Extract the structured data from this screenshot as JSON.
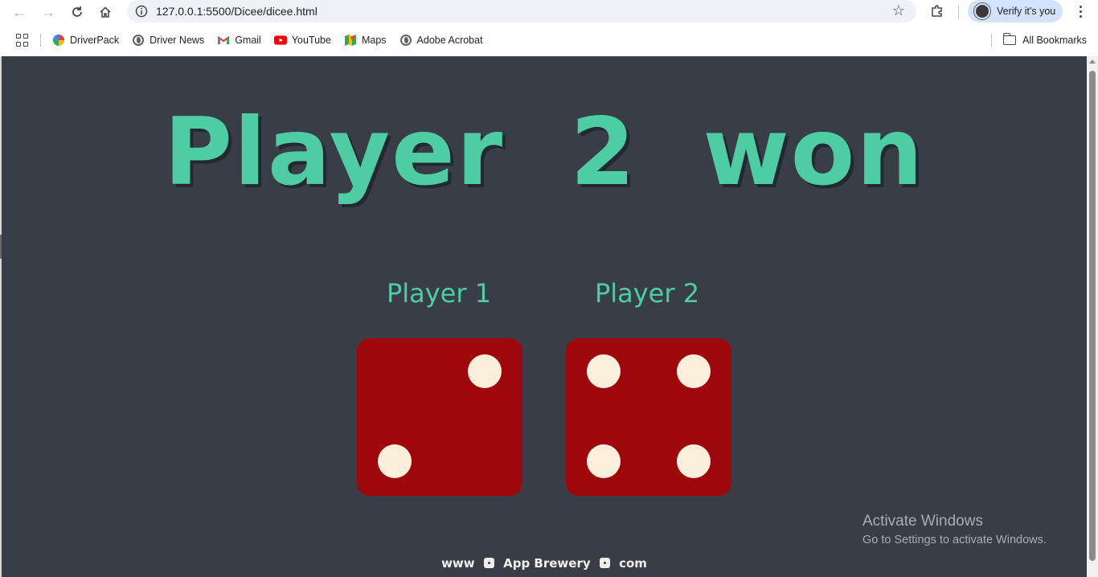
{
  "browser": {
    "url": "127.0.0.1:5500/Dicee/dicee.html",
    "profile_label": "Verify it's you",
    "bookmarks": [
      {
        "label": "DriverPack",
        "icon": "driverpack-icon"
      },
      {
        "label": "Driver News",
        "icon": "globe-icon"
      },
      {
        "label": "Gmail",
        "icon": "gmail-icon"
      },
      {
        "label": "YouTube",
        "icon": "youtube-icon"
      },
      {
        "label": "Maps",
        "icon": "maps-icon"
      },
      {
        "label": "Adobe Acrobat",
        "icon": "globe-icon"
      }
    ],
    "all_bookmarks_label": "All Bookmarks"
  },
  "page": {
    "headline": "Player 2 won",
    "players": [
      {
        "label": "Player 1",
        "die_value": 2
      },
      {
        "label": "Player 2",
        "die_value": 4
      }
    ],
    "footer": {
      "part1": "www",
      "part2": "App Brewery",
      "part3": "com"
    }
  },
  "watermark": {
    "line1": "Activate Windows",
    "line2": "Go to Settings to activate Windows."
  },
  "colors": {
    "background": "#393e46",
    "accent": "#4ecca3",
    "die": "#9e070c",
    "pip": "#fbeedb"
  }
}
